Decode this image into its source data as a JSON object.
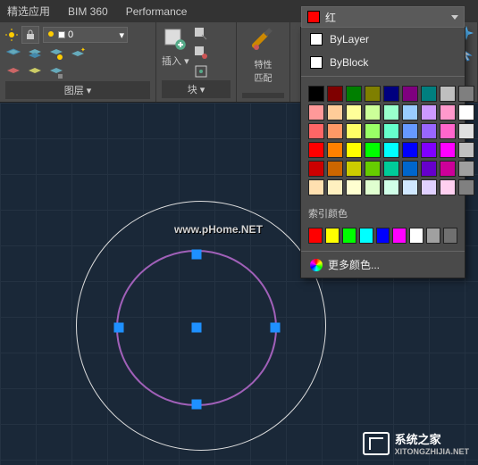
{
  "topbar": {
    "tab1": "精选应用",
    "tab2": "BIM 360",
    "tab3": "Performance"
  },
  "layer": {
    "current": "0",
    "panel_label": "图层",
    "dropdown_arrow": "▾"
  },
  "insert": {
    "label": "插入",
    "arrow": "▾"
  },
  "block": {
    "label": "块",
    "arrow": "▾"
  },
  "match": {
    "label": "特性\n匹配"
  },
  "color": {
    "current": "红",
    "bylayer": "ByLayer",
    "byblock": "ByBlock",
    "index_label": "索引颜色",
    "more": "更多颜色...",
    "dropdown_arrow": "▾"
  },
  "palette": [
    [
      "#000000",
      "#7f0000",
      "#007f00",
      "#7f7f00",
      "#00007f",
      "#7f007f",
      "#007f7f",
      "#bfbfbf",
      "#7f7f7f"
    ],
    [
      "#ff9999",
      "#ffcc99",
      "#ffff99",
      "#ccff99",
      "#99ffcc",
      "#99ccff",
      "#cc99ff",
      "#ff99cc",
      "#ffffff"
    ],
    [
      "#ff6666",
      "#ff9966",
      "#ffff66",
      "#99ff66",
      "#66ffcc",
      "#6699ff",
      "#9966ff",
      "#ff66cc",
      "#e0e0e0"
    ],
    [
      "#ff0000",
      "#ff8000",
      "#ffff00",
      "#00ff00",
      "#00ffff",
      "#0000ff",
      "#8000ff",
      "#ff00ff",
      "#c0c0c0"
    ],
    [
      "#cc0000",
      "#cc6600",
      "#cccc00",
      "#66cc00",
      "#00cc99",
      "#0066cc",
      "#6600cc",
      "#cc0099",
      "#a0a0a0"
    ],
    [
      "#ffe0b0",
      "#fff0c0",
      "#ffffd0",
      "#e0ffd0",
      "#d0ffe8",
      "#d0e8ff",
      "#e0d0ff",
      "#ffd0f0",
      "#808080"
    ]
  ],
  "index_colors": [
    "#ff0000",
    "#ffff00",
    "#00ff00",
    "#00ffff",
    "#0000ff",
    "#ff00ff",
    "#ffffff",
    "#a0a0a0",
    "#707070"
  ],
  "watermark1": "www.pHome.NET",
  "watermark2": {
    "title": "系统之家",
    "sub": "XITONGZHIJIA.NET"
  }
}
